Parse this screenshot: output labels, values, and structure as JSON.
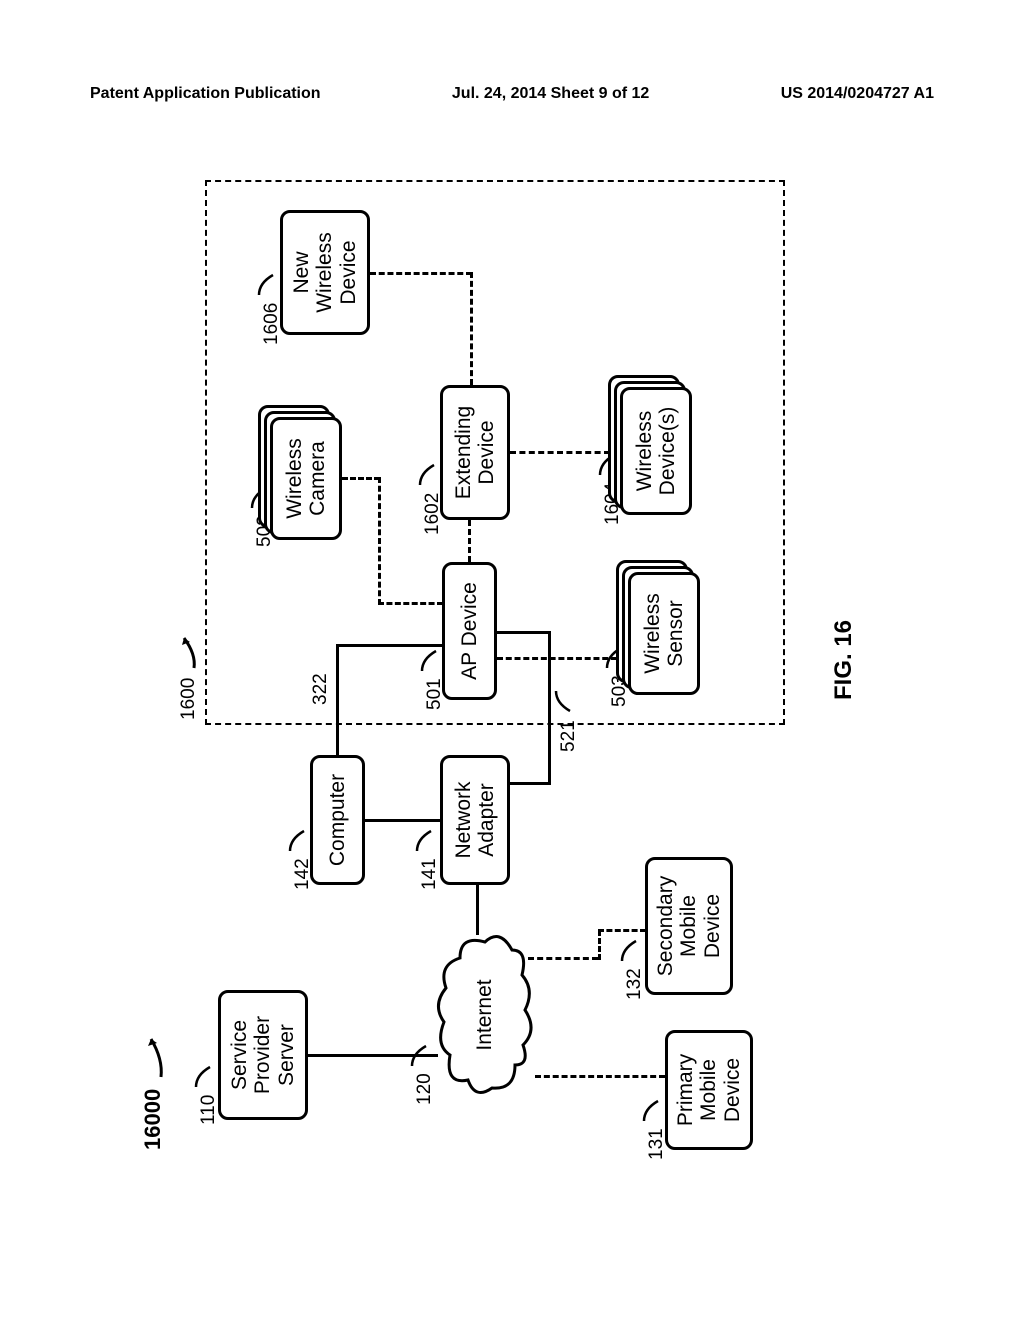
{
  "header": {
    "left": "Patent Application Publication",
    "mid": "Jul. 24, 2014  Sheet 9 of 12",
    "right": "US 2014/0204727 A1"
  },
  "figure": {
    "caption": "FIG. 16",
    "sys_label": "16000",
    "region_label": "1600"
  },
  "nodes": {
    "service_provider": "Service\nProvider\nServer",
    "internet": "Internet",
    "computer": "Computer",
    "network_adapter": "Network\nAdapter",
    "primary_mobile": "Primary\nMobile\nDevice",
    "secondary_mobile": "Secondary\nMobile\nDevice",
    "ap_device": "AP Device",
    "wireless_camera": "Wireless\nCamera",
    "wireless_sensor": "Wireless\nSensor",
    "extending_device": "Extending\nDevice",
    "wireless_devices": "Wireless\nDevice(s)",
    "new_wireless": "New\nWireless\nDevice"
  },
  "refs": {
    "service_provider": "110",
    "internet": "120",
    "primary_mobile": "131",
    "secondary_mobile": "132",
    "network_adapter": "141",
    "computer": "142",
    "ap_link": "322",
    "ap_device": "501",
    "wireless_camera": "502",
    "wireless_sensor": "503",
    "na_ap_link": "521",
    "extending_device": "1602",
    "wireless_devices": "1604",
    "new_wireless": "1606"
  }
}
